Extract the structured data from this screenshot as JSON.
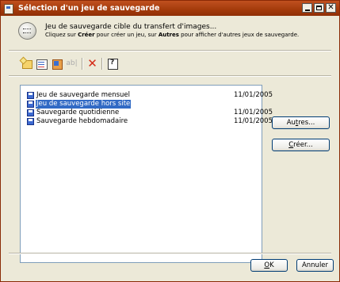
{
  "window": {
    "title": "Sélection d'un jeu de sauvegarde"
  },
  "header": {
    "title": "Jeu de sauvegarde cible du transfert d'images...",
    "subtitle_pre": "Cliquez sur ",
    "subtitle_create": "Créer",
    "subtitle_mid": " pour créer un jeu, sur ",
    "subtitle_others": "Autres",
    "subtitle_post": " pour afficher d'autres jeux de sauvegarde."
  },
  "toolbar": {
    "icons": [
      "new-folder-icon",
      "properties-icon",
      "delete-all-icon",
      "rename-icon",
      "delete-icon",
      "help-icon"
    ],
    "rename_text": "ab|",
    "delete_glyph": "✕"
  },
  "list": {
    "items": [
      {
        "name": "Jeu de sauvegarde mensuel",
        "date": "11/01/2005",
        "selected": false
      },
      {
        "name": "Jeu de sauvegarde hors site",
        "date": "",
        "selected": true
      },
      {
        "name": "Sauvegarde quotidienne",
        "date": "11/01/2005",
        "selected": false
      },
      {
        "name": "Sauvegarde hebdomadaire",
        "date": "11/01/2005",
        "selected": false
      }
    ]
  },
  "buttons": {
    "others_pre": "Au",
    "others_mnemonic": "t",
    "others_post": "res...",
    "create_mnemonic": "C",
    "create_post": "réer...",
    "ok_mnemonic": "O",
    "ok_post": "K",
    "cancel": "Annuler"
  },
  "colors": {
    "titlebar": "#a33a0b",
    "selection": "#316ac5",
    "dialog": "#ece9d8"
  }
}
